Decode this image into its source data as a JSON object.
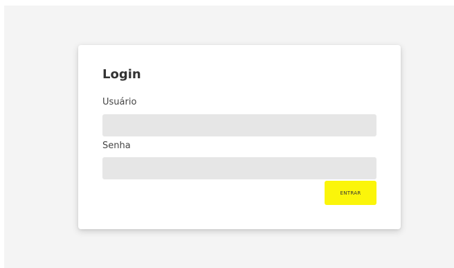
{
  "login": {
    "title": "Login",
    "username_label": "Usuário",
    "username_value": "",
    "password_label": "Senha",
    "password_value": "",
    "submit_label": "ENTRAR"
  },
  "colors": {
    "background": "#f4f4f4",
    "card": "#ffffff",
    "input_fill": "#e6e6e6",
    "button_accent": "#fbf50a"
  }
}
